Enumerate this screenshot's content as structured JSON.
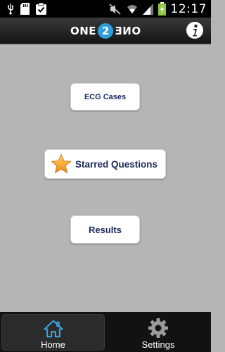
{
  "status_bar": {
    "time": "12:17",
    "left_icons": [
      "usb-icon",
      "sd-card-icon",
      "task-check-icon"
    ],
    "right_icons": [
      "mute-icon",
      "wifi-icon",
      "signal-icon",
      "battery-charging-icon"
    ]
  },
  "header": {
    "logo_left": "ONE",
    "logo_middle": "2",
    "logo_right": "ONE",
    "info_icon": "info-icon"
  },
  "menu": {
    "ecg_cases": "ECG Cases",
    "starred_questions": "Starred Questions",
    "results": "Results",
    "star_icon": "star-icon"
  },
  "tabs": [
    {
      "label": "Home",
      "icon": "home-icon",
      "selected": true
    },
    {
      "label": "Settings",
      "icon": "gear-icon",
      "selected": false
    }
  ],
  "colors": {
    "background": "#b5b5b5",
    "button_text": "#1a2a5e",
    "accent": "#2f9fdb",
    "star": "#f5a623"
  }
}
